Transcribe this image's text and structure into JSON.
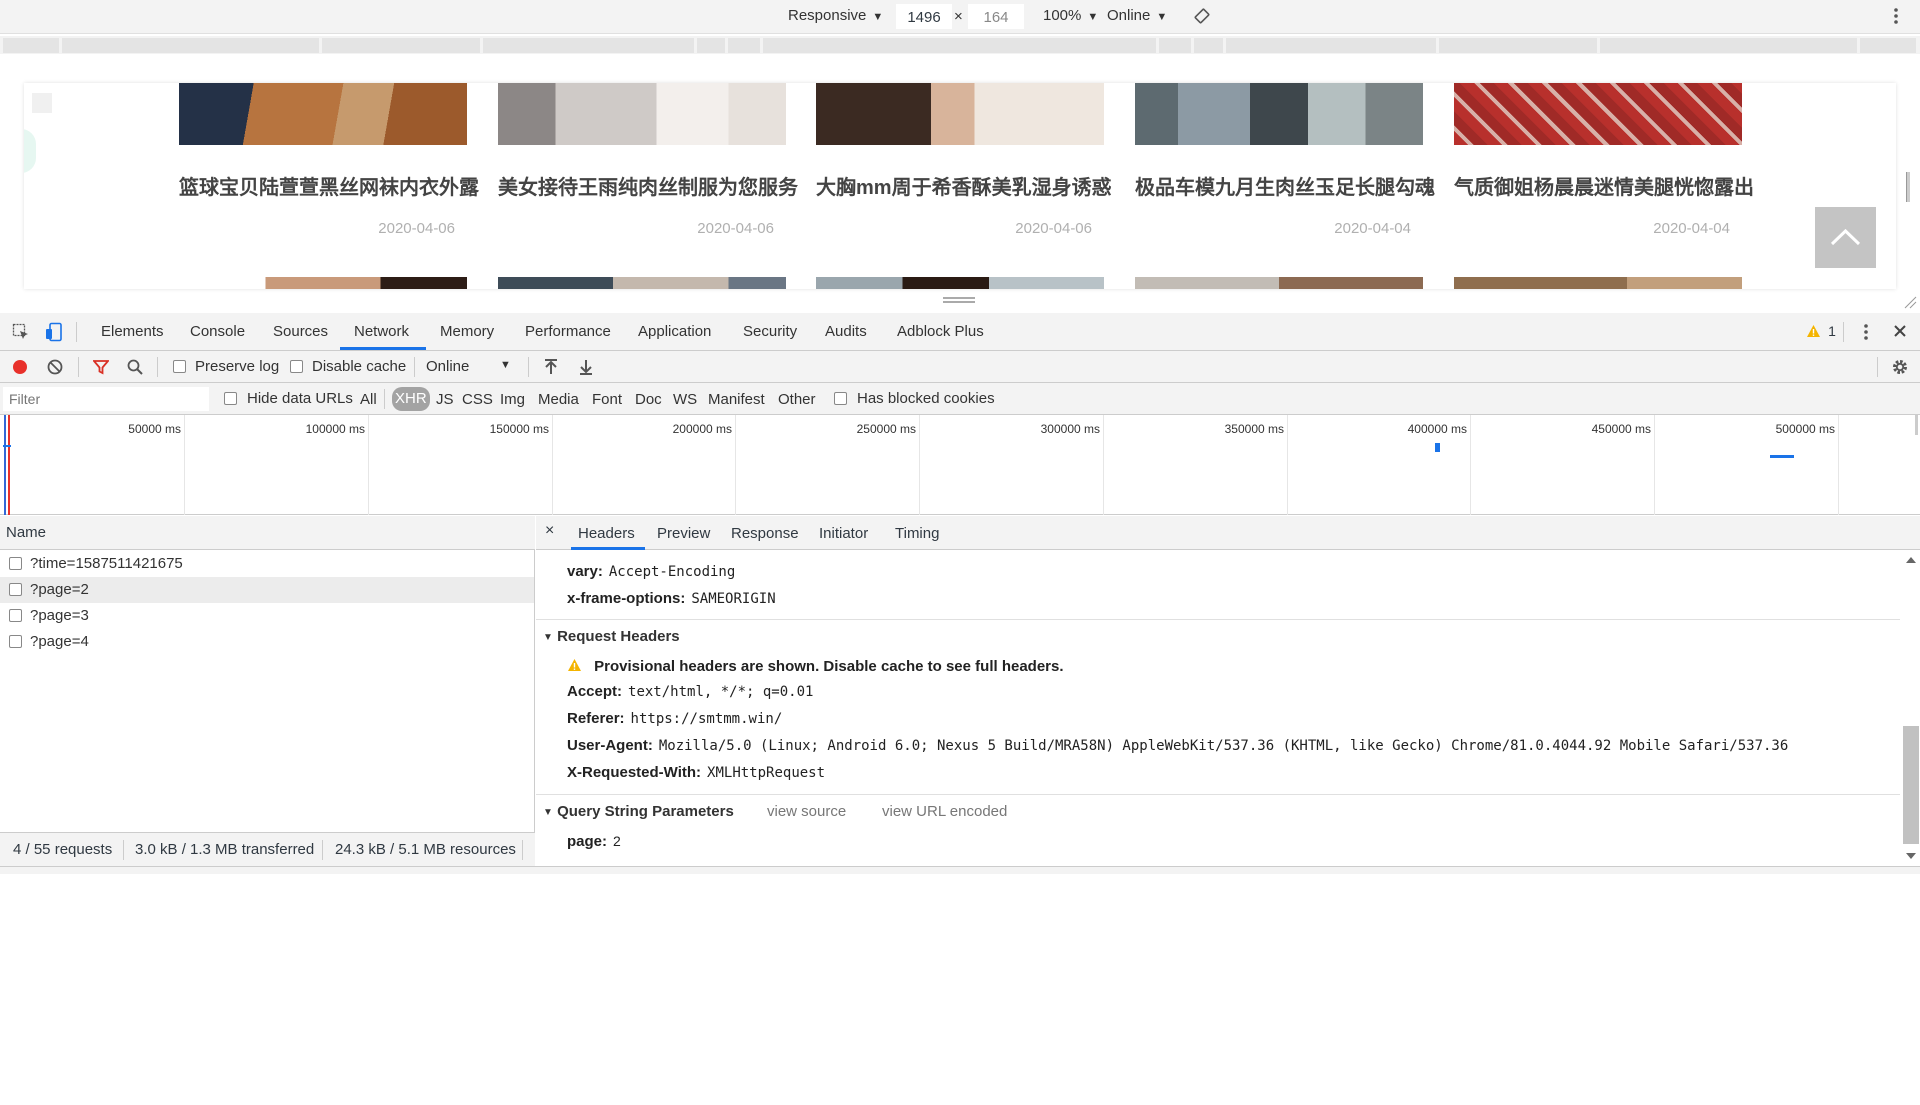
{
  "device_toolbar": {
    "device": "Responsive",
    "width": "1496",
    "times": "×",
    "height": "164",
    "zoom": "100%",
    "throttle": "Online"
  },
  "page": {
    "cards": [
      {
        "title": "篮球宝贝陆萱萱黑丝网袜内衣外露",
        "date": "2020-04-06",
        "thumb_color": "#a9643a"
      },
      {
        "title": "美女接待王雨纯肉丝制服为您服务",
        "date": "2020-04-06",
        "thumb_color": "#cfc9c6"
      },
      {
        "title": "大胸mm周于希香酥美乳湿身诱惑",
        "date": "2020-04-06",
        "thumb_color": "#7a5a48"
      },
      {
        "title": "极品车模九月生肉丝玉足长腿勾魂",
        "date": "2020-04-04",
        "thumb_color": "#6f7b80"
      },
      {
        "title": "气质御姐杨晨晨迷情美腿恍惚露出",
        "date": "2020-04-04",
        "thumb_color": "#b0302c"
      }
    ]
  },
  "devtools": {
    "tabs": [
      "Elements",
      "Console",
      "Sources",
      "Network",
      "Memory",
      "Performance",
      "Application",
      "Security",
      "Audits",
      "Adblock Plus"
    ],
    "active_tab": "Network",
    "warnings": "1",
    "network_toolbar": {
      "preserve_log": "Preserve log",
      "disable_cache": "Disable cache",
      "throttle": "Online"
    },
    "filter": {
      "placeholder": "Filter",
      "hide_data_urls": "Hide data URLs",
      "types": [
        "All",
        "XHR",
        "JS",
        "CSS",
        "Img",
        "Media",
        "Font",
        "Doc",
        "WS",
        "Manifest",
        "Other"
      ],
      "active_type": "XHR",
      "blocked_cookies": "Has blocked cookies"
    },
    "overview_ticks": [
      "50000 ms",
      "100000 ms",
      "150000 ms",
      "200000 ms",
      "250000 ms",
      "300000 ms",
      "350000 ms",
      "400000 ms",
      "450000 ms",
      "500000 ms"
    ],
    "request_list": {
      "header": "Name",
      "rows": [
        "?time=1587511421675",
        "?page=2",
        "?page=3",
        "?page=4"
      ],
      "selected_index": 1
    },
    "status": {
      "requests": "4 / 55 requests",
      "transferred": "3.0 kB / 1.3 MB transferred",
      "resources": "24.3 kB / 5.1 MB resources"
    },
    "details": {
      "close": "×",
      "tabs": [
        "Headers",
        "Preview",
        "Response",
        "Initiator",
        "Timing"
      ],
      "active_tab": "Headers",
      "response_headers_tail": [
        {
          "key": "vary:",
          "value": "Accept-Encoding"
        },
        {
          "key": "x-frame-options:",
          "value": "SAMEORIGIN"
        }
      ],
      "request_headers": {
        "title": "Request Headers",
        "warning": "Provisional headers are shown. Disable cache to see full headers.",
        "rows": [
          {
            "key": "Accept:",
            "value": "text/html, */*; q=0.01"
          },
          {
            "key": "Referer:",
            "value": "https://smtmm.win/"
          },
          {
            "key": "User-Agent:",
            "value": "Mozilla/5.0 (Linux; Android 6.0; Nexus 5 Build/MRA58N) AppleWebKit/537.36 (KHTML, like Gecko) Chrome/81.0.4044.92 Mobile Safari/537.36"
          },
          {
            "key": "X-Requested-With:",
            "value": "XMLHttpRequest"
          }
        ]
      },
      "query_params": {
        "title": "Query String Parameters",
        "view_source": "view source",
        "view_url_encoded": "view URL encoded",
        "rows": [
          {
            "key": "page:",
            "value": "2"
          }
        ]
      }
    }
  },
  "colors": {
    "accent": "#1a73e8",
    "record": "#e8302a",
    "filter_icon": "#d93025",
    "warning": "#f4b400"
  }
}
